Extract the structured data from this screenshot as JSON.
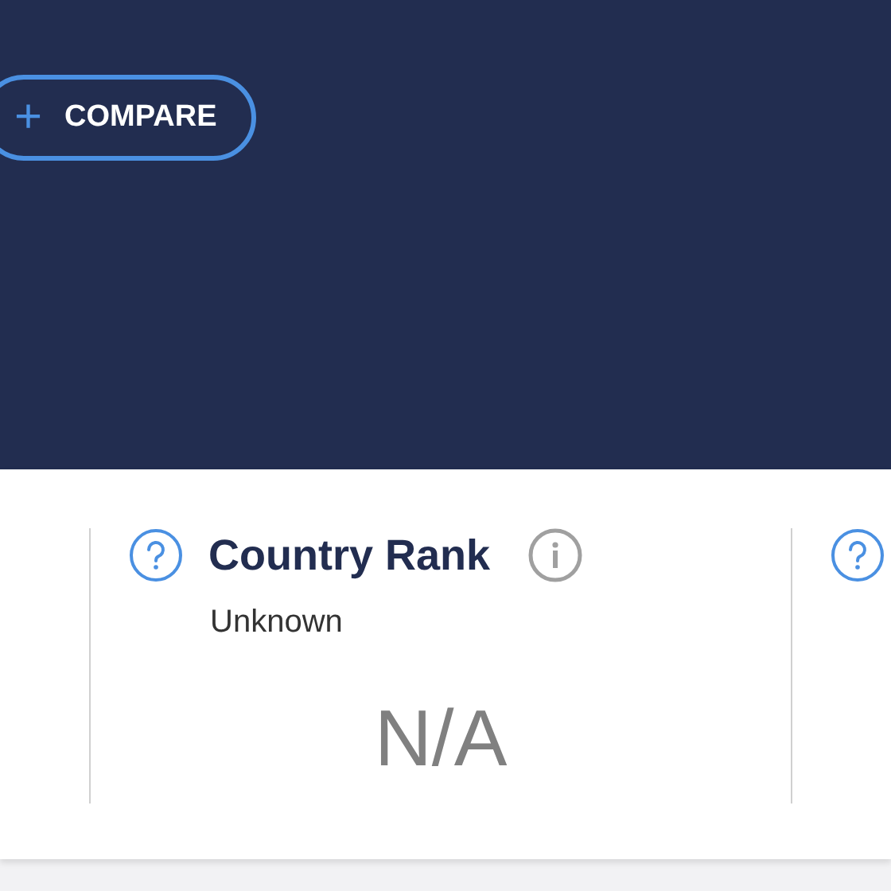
{
  "header": {
    "compare_button": {
      "icon": "+",
      "label": "COMPARE"
    }
  },
  "stats": [
    {
      "title": "Country Rank",
      "subtitle": "Unknown",
      "value": "N/A"
    }
  ]
}
